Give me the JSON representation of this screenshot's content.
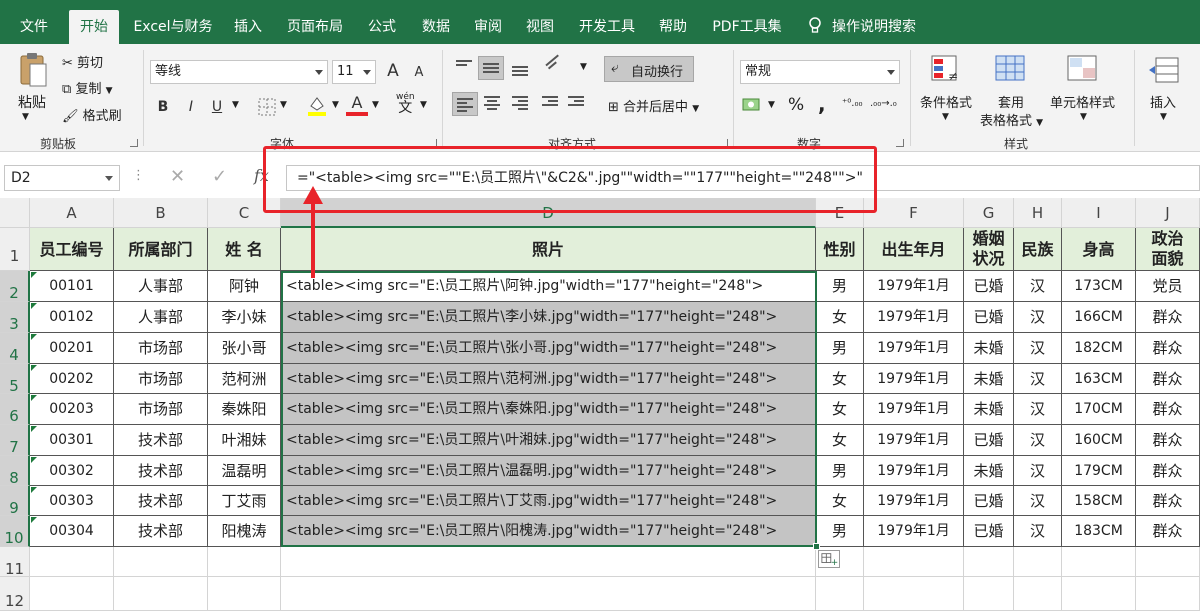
{
  "tabs": [
    "文件",
    "开始",
    "Excel与财务",
    "插入",
    "页面布局",
    "公式",
    "数据",
    "审阅",
    "视图",
    "开发工具",
    "帮助",
    "PDF工具集",
    "操作说明搜索"
  ],
  "ribbon": {
    "paste": "粘贴",
    "cut": "剪切",
    "copy": "复制",
    "format_painter": "格式刷",
    "clipboard": "剪贴板",
    "font_name": "等线",
    "font_size": "11",
    "font_group": "字体",
    "wrap": "自动换行",
    "merge": "合并后居中",
    "align_group": "对齐方式",
    "number_format": "常规",
    "number_group": "数字",
    "cond_format": "条件格式",
    "table_format_1": "套用",
    "table_format_2": "表格格式",
    "cell_style": "单元格样式",
    "style_group": "样式",
    "insert": "插入",
    "bold": "B",
    "italic": "I",
    "underline": "U",
    "grow_font": "A",
    "shrink_font": "A",
    "percent": "%",
    "comma": ",",
    "wen": "wén",
    "wen_char": "文",
    "fx": "fx"
  },
  "formula_bar": {
    "name_box": "D2",
    "formula": "=\"<table><img src=\"\"E:\\员工照片\\\"&C2&\".jpg\"\"width=\"\"177\"\"height=\"\"248\"\">\""
  },
  "columns": [
    "A",
    "B",
    "C",
    "D",
    "E",
    "F",
    "G",
    "H",
    "I",
    "J"
  ],
  "rows": [
    "1",
    "2",
    "3",
    "4",
    "5",
    "6",
    "7",
    "8",
    "9",
    "10",
    "11",
    "12"
  ],
  "headers": {
    "id": "员工编号",
    "dept": "所属部门",
    "name": "姓 名",
    "photo": "照片",
    "gender": "性别",
    "birth": "出生年月",
    "marital_1": "婚姻",
    "marital_2": "状况",
    "ethnic": "民族",
    "height": "身高",
    "political_1": "政治",
    "political_2": "面貌"
  },
  "table": [
    {
      "id": "00101",
      "dept": "人事部",
      "name": "阿钟",
      "photo": "<table><img src=\"E:\\员工照片\\阿钟.jpg\"width=\"177\"height=\"248\">",
      "gender": "男",
      "birth": "1979年1月",
      "marital": "已婚",
      "ethnic": "汉",
      "height": "173CM",
      "political": "党员"
    },
    {
      "id": "00102",
      "dept": "人事部",
      "name": "李小妹",
      "photo": "<table><img src=\"E:\\员工照片\\李小妹.jpg\"width=\"177\"height=\"248\">",
      "gender": "女",
      "birth": "1979年1月",
      "marital": "已婚",
      "ethnic": "汉",
      "height": "166CM",
      "political": "群众"
    },
    {
      "id": "00201",
      "dept": "市场部",
      "name": "张小哥",
      "photo": "<table><img src=\"E:\\员工照片\\张小哥.jpg\"width=\"177\"height=\"248\">",
      "gender": "男",
      "birth": "1979年1月",
      "marital": "未婚",
      "ethnic": "汉",
      "height": "182CM",
      "political": "群众"
    },
    {
      "id": "00202",
      "dept": "市场部",
      "name": "范柯洲",
      "photo": "<table><img src=\"E:\\员工照片\\范柯洲.jpg\"width=\"177\"height=\"248\">",
      "gender": "女",
      "birth": "1979年1月",
      "marital": "未婚",
      "ethnic": "汉",
      "height": "163CM",
      "political": "群众"
    },
    {
      "id": "00203",
      "dept": "市场部",
      "name": "秦姝阳",
      "photo": "<table><img src=\"E:\\员工照片\\秦姝阳.jpg\"width=\"177\"height=\"248\">",
      "gender": "女",
      "birth": "1979年1月",
      "marital": "未婚",
      "ethnic": "汉",
      "height": "170CM",
      "political": "群众"
    },
    {
      "id": "00301",
      "dept": "技术部",
      "name": "叶湘妹",
      "photo": "<table><img src=\"E:\\员工照片\\叶湘妹.jpg\"width=\"177\"height=\"248\">",
      "gender": "女",
      "birth": "1979年1月",
      "marital": "已婚",
      "ethnic": "汉",
      "height": "160CM",
      "political": "群众"
    },
    {
      "id": "00302",
      "dept": "技术部",
      "name": "温磊明",
      "photo": "<table><img src=\"E:\\员工照片\\温磊明.jpg\"width=\"177\"height=\"248\">",
      "gender": "男",
      "birth": "1979年1月",
      "marital": "未婚",
      "ethnic": "汉",
      "height": "179CM",
      "political": "群众"
    },
    {
      "id": "00303",
      "dept": "技术部",
      "name": "丁艾雨",
      "photo": "<table><img src=\"E:\\员工照片\\丁艾雨.jpg\"width=\"177\"height=\"248\">",
      "gender": "女",
      "birth": "1979年1月",
      "marital": "已婚",
      "ethnic": "汉",
      "height": "158CM",
      "political": "群众"
    },
    {
      "id": "00304",
      "dept": "技术部",
      "name": "阳槐涛",
      "photo": "<table><img src=\"E:\\员工照片\\阳槐涛.jpg\"width=\"177\"height=\"248\">",
      "gender": "男",
      "birth": "1979年1月",
      "marital": "已婚",
      "ethnic": "汉",
      "height": "183CM",
      "political": "群众"
    }
  ],
  "colors": {
    "excel_green": "#217346",
    "selection_fill": "#c4c4c4",
    "header_fill": "#e2efda",
    "annotation_red": "#e8232a"
  }
}
